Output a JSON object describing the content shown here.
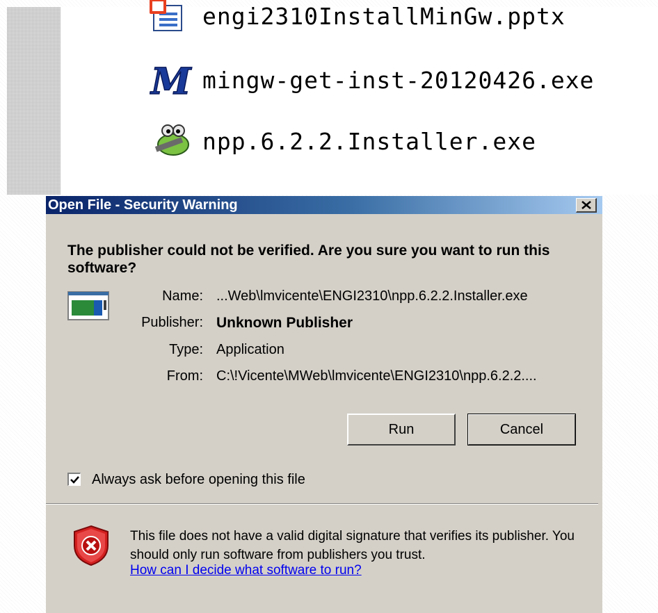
{
  "explorer": {
    "files": [
      {
        "name": "engi2310InstallMinGw.pptx",
        "icon": "pptx-icon"
      },
      {
        "name": "mingw-get-inst-20120426.exe",
        "icon": "mingw-icon"
      },
      {
        "name": "npp.6.2.2.Installer.exe",
        "icon": "notepadpp-icon"
      }
    ]
  },
  "dialog": {
    "title": "Open File - Security Warning",
    "heading": "The publisher could not be verified.  Are you sure you want to run this software?",
    "fields": {
      "name_label": "Name:",
      "name_value": "...Web\\lmvicente\\ENGI2310\\npp.6.2.2.Installer.exe",
      "publisher_label": "Publisher:",
      "publisher_value": "Unknown Publisher",
      "type_label": "Type:",
      "type_value": "Application",
      "from_label": "From:",
      "from_value": "C:\\!Vicente\\MWeb\\lmvicente\\ENGI2310\\npp.6.2.2...."
    },
    "buttons": {
      "run": "Run",
      "cancel": "Cancel"
    },
    "checkbox": {
      "label": "Always ask before opening this file",
      "checked": true
    },
    "warning_text": "This file does not have a valid digital signature that verifies its publisher.  You should only run software from publishers you trust.",
    "help_link": "How can I decide what software to run?"
  },
  "colors": {
    "titlebar_start": "#0a246a",
    "titlebar_end": "#a6caf0",
    "dialog_bg": "#d4d0c8",
    "link": "#0000ee",
    "shield_red": "#d42020"
  }
}
